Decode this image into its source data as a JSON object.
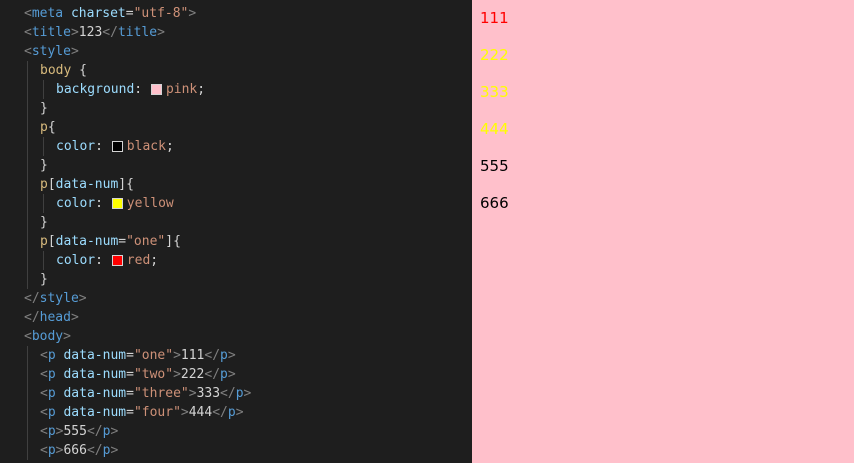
{
  "colors": {
    "editor_bg": "#1e1e1e",
    "preview_bg": "#ffc0cb",
    "swatch_pink": "#ffc0cb",
    "swatch_black": "#000000",
    "swatch_yellow": "#ffff00",
    "swatch_red": "#ff0000",
    "para_red": "#ff0000",
    "para_yellow": "#ffff00",
    "para_black": "#000000"
  },
  "editor": {
    "lines": [
      {
        "indent": 1,
        "tokens": [
          {
            "c": "punct",
            "t": "<"
          },
          {
            "c": "tag",
            "t": "meta"
          },
          {
            "c": "text",
            "t": " "
          },
          {
            "c": "attr",
            "t": "charset"
          },
          {
            "c": "text",
            "t": "="
          },
          {
            "c": "str",
            "t": "\"utf-8\""
          },
          {
            "c": "punct",
            "t": ">"
          }
        ]
      },
      {
        "indent": 1,
        "tokens": [
          {
            "c": "punct",
            "t": "<"
          },
          {
            "c": "tag",
            "t": "title"
          },
          {
            "c": "punct",
            "t": ">"
          },
          {
            "c": "text",
            "t": "123"
          },
          {
            "c": "punct",
            "t": "</"
          },
          {
            "c": "tag",
            "t": "title"
          },
          {
            "c": "punct",
            "t": ">"
          }
        ]
      },
      {
        "indent": 1,
        "tokens": [
          {
            "c": "punct",
            "t": "<"
          },
          {
            "c": "tag",
            "t": "style"
          },
          {
            "c": "punct",
            "t": ">"
          }
        ]
      },
      {
        "indent": 2,
        "tokens": [
          {
            "c": "sel",
            "t": "body"
          },
          {
            "c": "brace",
            "t": " {"
          }
        ]
      },
      {
        "indent": 3,
        "tokens": [
          {
            "c": "prop",
            "t": "background"
          },
          {
            "c": "brace",
            "t": ": "
          },
          {
            "c": "swatch",
            "color": "swatch_pink"
          },
          {
            "c": "val",
            "t": "pink"
          },
          {
            "c": "brace",
            "t": ";"
          }
        ]
      },
      {
        "indent": 2,
        "tokens": [
          {
            "c": "brace",
            "t": "}"
          }
        ]
      },
      {
        "indent": 2,
        "tokens": [
          {
            "c": "sel",
            "t": "p"
          },
          {
            "c": "brace",
            "t": "{"
          }
        ]
      },
      {
        "indent": 3,
        "tokens": [
          {
            "c": "prop",
            "t": "color"
          },
          {
            "c": "brace",
            "t": ": "
          },
          {
            "c": "swatch",
            "color": "swatch_black"
          },
          {
            "c": "val",
            "t": "black"
          },
          {
            "c": "brace",
            "t": ";"
          }
        ]
      },
      {
        "indent": 2,
        "tokens": [
          {
            "c": "brace",
            "t": "}"
          }
        ]
      },
      {
        "indent": 2,
        "tokens": [
          {
            "c": "sel",
            "t": "p"
          },
          {
            "c": "brace",
            "t": "["
          },
          {
            "c": "attr",
            "t": "data-num"
          },
          {
            "c": "brace",
            "t": "]{"
          }
        ]
      },
      {
        "indent": 3,
        "tokens": [
          {
            "c": "prop",
            "t": "color"
          },
          {
            "c": "brace",
            "t": ": "
          },
          {
            "c": "swatch",
            "color": "swatch_yellow"
          },
          {
            "c": "val",
            "t": "yellow"
          }
        ]
      },
      {
        "indent": 2,
        "tokens": [
          {
            "c": "brace",
            "t": "}"
          }
        ]
      },
      {
        "indent": 2,
        "tokens": [
          {
            "c": "sel",
            "t": "p"
          },
          {
            "c": "brace",
            "t": "["
          },
          {
            "c": "attr",
            "t": "data-num"
          },
          {
            "c": "brace",
            "t": "="
          },
          {
            "c": "str",
            "t": "\"one\""
          },
          {
            "c": "brace",
            "t": "]{"
          }
        ]
      },
      {
        "indent": 3,
        "tokens": [
          {
            "c": "prop",
            "t": "color"
          },
          {
            "c": "brace",
            "t": ": "
          },
          {
            "c": "swatch",
            "color": "swatch_red"
          },
          {
            "c": "val",
            "t": "red"
          },
          {
            "c": "brace",
            "t": ";"
          }
        ]
      },
      {
        "indent": 2,
        "tokens": [
          {
            "c": "brace",
            "t": "}"
          }
        ]
      },
      {
        "indent": 1,
        "tokens": [
          {
            "c": "punct",
            "t": "</"
          },
          {
            "c": "tag",
            "t": "style"
          },
          {
            "c": "punct",
            "t": ">"
          }
        ]
      },
      {
        "indent": 1,
        "tokens": [
          {
            "c": "punct",
            "t": "</"
          },
          {
            "c": "tag",
            "t": "head"
          },
          {
            "c": "punct",
            "t": ">"
          }
        ]
      },
      {
        "indent": 1,
        "tokens": [
          {
            "c": "punct",
            "t": "<"
          },
          {
            "c": "tag",
            "t": "body"
          },
          {
            "c": "punct",
            "t": ">"
          }
        ]
      },
      {
        "indent": 2,
        "tokens": [
          {
            "c": "punct",
            "t": "<"
          },
          {
            "c": "tag",
            "t": "p"
          },
          {
            "c": "text",
            "t": " "
          },
          {
            "c": "attr",
            "t": "data-num"
          },
          {
            "c": "text",
            "t": "="
          },
          {
            "c": "str",
            "t": "\"one\""
          },
          {
            "c": "punct",
            "t": ">"
          },
          {
            "c": "text",
            "t": "111"
          },
          {
            "c": "punct",
            "t": "</"
          },
          {
            "c": "tag",
            "t": "p"
          },
          {
            "c": "punct",
            "t": ">"
          }
        ]
      },
      {
        "indent": 2,
        "tokens": [
          {
            "c": "punct",
            "t": "<"
          },
          {
            "c": "tag",
            "t": "p"
          },
          {
            "c": "text",
            "t": " "
          },
          {
            "c": "attr",
            "t": "data-num"
          },
          {
            "c": "text",
            "t": "="
          },
          {
            "c": "str",
            "t": "\"two\""
          },
          {
            "c": "punct",
            "t": ">"
          },
          {
            "c": "text",
            "t": "222"
          },
          {
            "c": "punct",
            "t": "</"
          },
          {
            "c": "tag",
            "t": "p"
          },
          {
            "c": "punct",
            "t": ">"
          }
        ]
      },
      {
        "indent": 2,
        "tokens": [
          {
            "c": "punct",
            "t": "<"
          },
          {
            "c": "tag",
            "t": "p"
          },
          {
            "c": "text",
            "t": " "
          },
          {
            "c": "attr",
            "t": "data-num"
          },
          {
            "c": "text",
            "t": "="
          },
          {
            "c": "str",
            "t": "\"three\""
          },
          {
            "c": "punct",
            "t": ">"
          },
          {
            "c": "text",
            "t": "333"
          },
          {
            "c": "punct",
            "t": "</"
          },
          {
            "c": "tag",
            "t": "p"
          },
          {
            "c": "punct",
            "t": ">"
          }
        ]
      },
      {
        "indent": 2,
        "tokens": [
          {
            "c": "punct",
            "t": "<"
          },
          {
            "c": "tag",
            "t": "p"
          },
          {
            "c": "text",
            "t": " "
          },
          {
            "c": "attr",
            "t": "data-num"
          },
          {
            "c": "text",
            "t": "="
          },
          {
            "c": "str",
            "t": "\"four\""
          },
          {
            "c": "punct",
            "t": ">"
          },
          {
            "c": "text",
            "t": "444"
          },
          {
            "c": "punct",
            "t": "</"
          },
          {
            "c": "tag",
            "t": "p"
          },
          {
            "c": "punct",
            "t": ">"
          }
        ]
      },
      {
        "indent": 2,
        "tokens": [
          {
            "c": "punct",
            "t": "<"
          },
          {
            "c": "tag",
            "t": "p"
          },
          {
            "c": "punct",
            "t": ">"
          },
          {
            "c": "text",
            "t": "555"
          },
          {
            "c": "punct",
            "t": "</"
          },
          {
            "c": "tag",
            "t": "p"
          },
          {
            "c": "punct",
            "t": ">"
          }
        ]
      },
      {
        "indent": 2,
        "tokens": [
          {
            "c": "punct",
            "t": "<"
          },
          {
            "c": "tag",
            "t": "p"
          },
          {
            "c": "punct",
            "t": ">"
          },
          {
            "c": "text",
            "t": "666"
          },
          {
            "c": "punct",
            "t": "</"
          },
          {
            "c": "tag",
            "t": "p"
          },
          {
            "c": "punct",
            "t": ">"
          }
        ]
      }
    ]
  },
  "preview": {
    "paragraphs": [
      {
        "text": "111",
        "color": "para_red"
      },
      {
        "text": "222",
        "color": "para_yellow"
      },
      {
        "text": "333",
        "color": "para_yellow"
      },
      {
        "text": "444",
        "color": "para_yellow"
      },
      {
        "text": "555",
        "color": "para_black"
      },
      {
        "text": "666",
        "color": "para_black"
      }
    ]
  }
}
